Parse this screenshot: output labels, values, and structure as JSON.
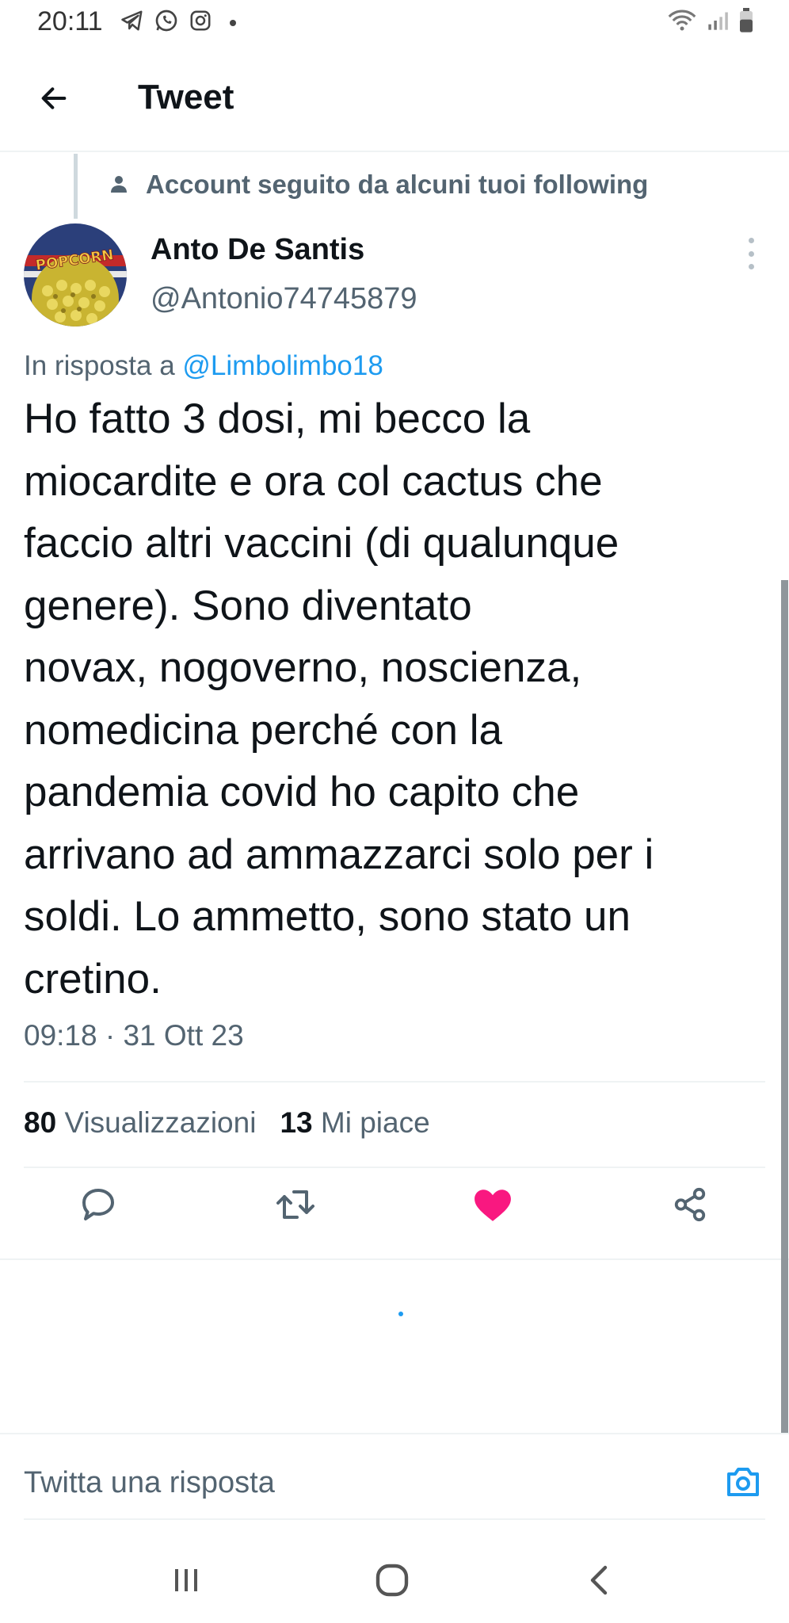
{
  "status_bar": {
    "time": "20:11",
    "left_icons": [
      "telegram-icon",
      "whatsapp-icon",
      "instagram-icon"
    ],
    "right_icons": [
      "wifi-icon",
      "signal-icon",
      "battery-icon"
    ]
  },
  "header": {
    "title": "Tweet"
  },
  "tweet": {
    "social_context": "Account seguito da alcuni tuoi following",
    "author_name": "Anto De Santis",
    "author_handle": "@Antonio74745879",
    "avatar_text": "POPCORN",
    "reply_prefix": "In risposta a ",
    "reply_mention": "@Limbolimbo18",
    "text": "Ho fatto 3 dosi, mi becco la\nmiocardite e ora col cactus che\nfaccio altri vaccini (di qualunque\ngenere). Sono diventato\nnovax, nogoverno, noscienza,\nnomedicina perché con la\npandemia covid ho capito che\narrivano ad ammazzarci solo per i\nsoldi. Lo ammetto, sono stato un\ncretino.",
    "timestamp": "09:18 · 31 Ott 23",
    "views_count": "80",
    "views_label": "Visualizzazioni",
    "likes_count": "13",
    "likes_label": "Mi piace",
    "liked": true
  },
  "reply_box": {
    "placeholder": "Twitta una risposta"
  },
  "colors": {
    "accent": "#1d9bf0",
    "like": "#f91880",
    "secondary_text": "#536471",
    "primary_text": "#0f1419"
  }
}
